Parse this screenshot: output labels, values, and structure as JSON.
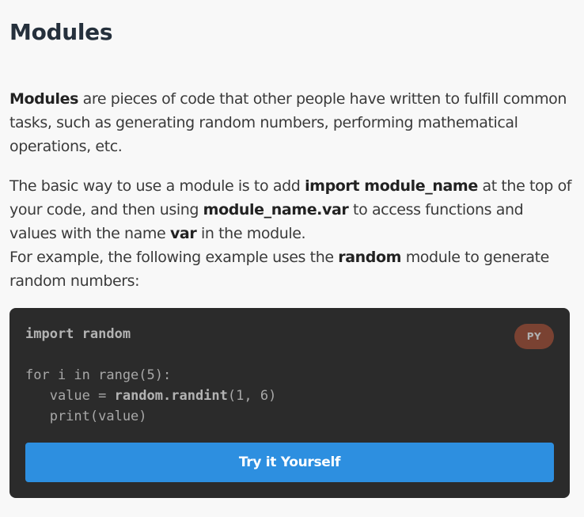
{
  "heading": "Modules",
  "paragraph1": {
    "bold_lead": "Modules",
    "rest": " are pieces of code that other people have written to fulfill common tasks, such as generating random numbers, performing mathematical operations, etc."
  },
  "paragraph2": {
    "t1": "The basic way to use a module is to add ",
    "b1": "import module_name",
    "t2": " at the top of your code, and then using ",
    "b2": "module_name.var",
    "t3": " to access functions and values with the name ",
    "b3": "var",
    "t4": " in the module.",
    "t5": "For example, the following example uses the ",
    "b4": "random",
    "t6": " module to generate random numbers:"
  },
  "code_block": {
    "language_badge": "PY",
    "line1_kw": "import random",
    "line2": "for i in range(5):",
    "line3_pre": "   value = ",
    "line3_kw": "random.randint",
    "line3_post": "(1, 6)",
    "line4": "   print(value)",
    "button_label": "Try it Yourself"
  },
  "colors": {
    "page_bg": "#f8f8f8",
    "code_bg": "#2b2b2b",
    "badge_bg": "#7a4232",
    "button_bg": "#2d8fe0"
  }
}
